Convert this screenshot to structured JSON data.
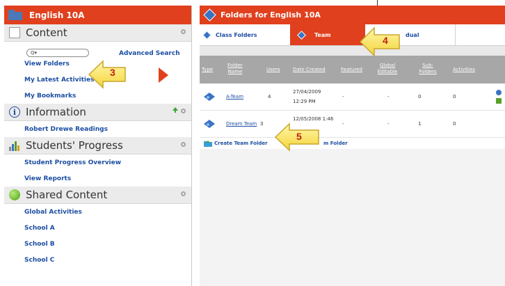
{
  "left": {
    "title": "English 10A",
    "content_section": "Content",
    "search_placeholder": "Q▾",
    "advanced_search": "Advanced Search",
    "view_folders": "View Folders",
    "latest": "My Latest Activities",
    "bookmarks": "My Bookmarks",
    "info_section": "Information",
    "readings": "Robert Drewe Readings",
    "progress_section": "Students' Progress",
    "progress_overview": "Student Progress Overview",
    "view_reports": "View Reports",
    "shared_section": "Shared Content",
    "global": "Global Activities",
    "school_a": "School A",
    "school_b": "School B",
    "school_c": "School C"
  },
  "right": {
    "title": "Folders for English 10A",
    "tab_class": "Class Folders",
    "tab_team": "Team",
    "tab_individual": "dual",
    "cols": {
      "type": "Type",
      "folder": "Folder Name",
      "users": "Users",
      "date": "Date Created",
      "featured": "Featured",
      "global": "Global Editable",
      "sub": "Sub-Folders",
      "activities": "Activities"
    },
    "rows": [
      {
        "name": "A-Team",
        "users": "4",
        "date": "27/04/2009",
        "time": "12:29 PM",
        "featured": "-",
        "global": "-",
        "sub": "0",
        "activities": "0"
      },
      {
        "name": "Dream Team",
        "users": "3",
        "date": "12/05/2008 1:46",
        "time": "",
        "featured": "-",
        "global": "-",
        "sub": "1",
        "activities": "0"
      }
    ],
    "create_team": "Create Team Folder",
    "create_other": "m Folder"
  },
  "callouts": {
    "c3": "3",
    "c4": "4",
    "c5": "5"
  },
  "colors": {
    "accent": "#e0401d",
    "link": "#1c4ea3",
    "callout": "#f8e14a"
  }
}
